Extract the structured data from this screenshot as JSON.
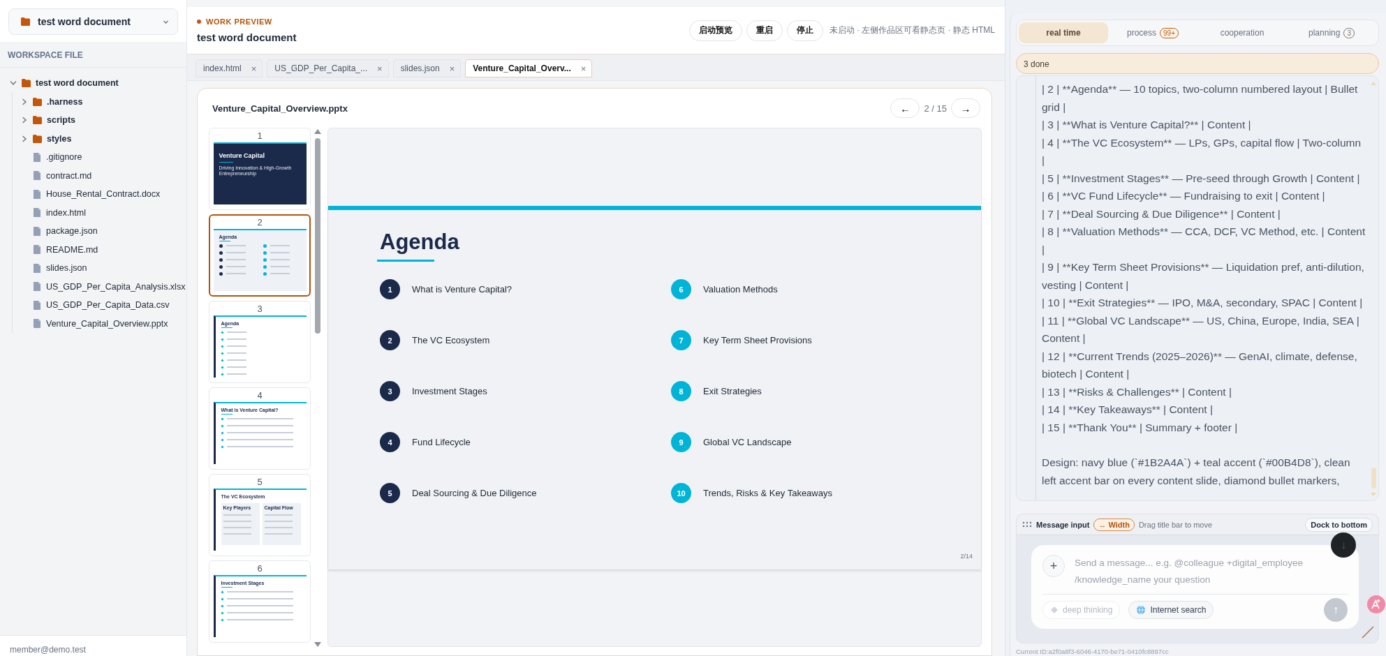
{
  "workspace_selector": {
    "label": "test word document"
  },
  "sidebar": {
    "heading": "WORKSPACE FILE",
    "user": "member@demo.test",
    "tree": [
      {
        "kind": "folder",
        "name": "test word document",
        "expanded": true,
        "children": [
          {
            "kind": "folder",
            "name": ".harness",
            "expanded": false
          },
          {
            "kind": "folder",
            "name": "scripts",
            "expanded": false
          },
          {
            "kind": "folder",
            "name": "styles",
            "expanded": false
          },
          {
            "kind": "file",
            "name": ".gitignore"
          },
          {
            "kind": "file",
            "name": "contract.md"
          },
          {
            "kind": "file",
            "name": "House_Rental_Contract.docx"
          },
          {
            "kind": "file",
            "name": "index.html"
          },
          {
            "kind": "file",
            "name": "package.json"
          },
          {
            "kind": "file",
            "name": "README.md"
          },
          {
            "kind": "file",
            "name": "slides.json"
          },
          {
            "kind": "file",
            "name": "US_GDP_Per_Capita_Analysis.xlsx"
          },
          {
            "kind": "file",
            "name": "US_GDP_Per_Capita_Data.csv"
          },
          {
            "kind": "file",
            "name": "Venture_Capital_Overview.pptx"
          }
        ]
      }
    ]
  },
  "preview": {
    "eyebrow": "WORK PREVIEW",
    "title": "test word document",
    "buttons": [
      "启动预览",
      "重启",
      "停止"
    ],
    "status": "未启动 · 左侧作品区可看静态页 · 静态 HTML",
    "tabs": [
      {
        "label": "index.html",
        "close": "×",
        "selected": false
      },
      {
        "label": "US_GDP_Per_Capita_...",
        "close": "×",
        "selected": false
      },
      {
        "label": "slides.json",
        "close": "×",
        "selected": false
      },
      {
        "label": "Venture_Capital_Overv...",
        "close": "×",
        "selected": true
      }
    ],
    "viewer": {
      "file": "Venture_Capital_Overview.pptx",
      "prev": "←",
      "page": "2 / 15",
      "next": "→",
      "thumbnails": [
        {
          "number": "1",
          "kind": "title",
          "title": "Venture Capital",
          "subtitle": "Driving Innovation & High-Growth Entrepreneurship",
          "selected": false
        },
        {
          "number": "2",
          "kind": "agenda",
          "title": "Agenda",
          "selected": true
        },
        {
          "number": "3",
          "kind": "list",
          "title": "Agenda",
          "selected": false
        },
        {
          "number": "4",
          "kind": "bullets",
          "title": "What is Venture Capital?",
          "selected": false
        },
        {
          "number": "5",
          "kind": "columns",
          "title": "The VC Ecosystem",
          "column_titles": [
            "Key Players",
            "Capital Flow"
          ],
          "selected": false
        },
        {
          "number": "6",
          "kind": "bullets",
          "title": "Investment Stages",
          "selected": false
        }
      ],
      "slide": {
        "title": "Agenda",
        "page": "2/14",
        "items": [
          {
            "number": "1",
            "label": "What is Venture Capital?",
            "color": "#1b2a4a"
          },
          {
            "number": "6",
            "label": "Valuation Methods",
            "color": "#00b4d8"
          },
          {
            "number": "2",
            "label": "The VC Ecosystem",
            "color": "#1b2a4a"
          },
          {
            "number": "7",
            "label": "Key Term Sheet Provisions",
            "color": "#00b4d8"
          },
          {
            "number": "3",
            "label": "Investment Stages",
            "color": "#1b2a4a"
          },
          {
            "number": "8",
            "label": "Exit Strategies",
            "color": "#00b4d8"
          },
          {
            "number": "4",
            "label": "Fund Lifecycle",
            "color": "#1b2a4a"
          },
          {
            "number": "9",
            "label": "Global VC Landscape",
            "color": "#00b4d8"
          },
          {
            "number": "5",
            "label": "Deal Sourcing & Due Diligence",
            "color": "#1b2a4a"
          },
          {
            "number": "10",
            "label": "Trends, Risks & Key Takeaways",
            "color": "#00b4d8"
          }
        ]
      }
    }
  },
  "assistant": {
    "tabs": [
      {
        "label": "real time",
        "selected": true
      },
      {
        "label": "process",
        "badge": {
          "text": "99+",
          "color": "#c2570c"
        },
        "selected": false
      },
      {
        "label": "cooperation",
        "selected": false
      },
      {
        "label": "planning",
        "badge": {
          "text": "3",
          "color": "#64748b"
        },
        "selected": false
      }
    ],
    "progress": "3 done",
    "messages": [
      "| 2 | **Agenda** — 10 topics, two-column numbered layout | Bullet grid |",
      "| 3 | **What is Venture Capital?** | Content |",
      "| 4 | **The VC Ecosystem** — LPs, GPs, capital flow | Two-column |",
      "| 5 | **Investment Stages** — Pre-seed through Growth | Content |",
      "| 6 | **VC Fund Lifecycle** — Fundraising to exit | Content |",
      "| 7 | **Deal Sourcing & Due Diligence** | Content |",
      "| 8 | **Valuation Methods** — CCA, DCF, VC Method, etc. | Content |",
      "| 9 | **Key Term Sheet Provisions** — Liquidation pref, anti-dilution, vesting | Content |",
      "| 10 | **Exit Strategies** — IPO, M&A, secondary, SPAC | Content |",
      "| 11 | **Global VC Landscape** — US, China, Europe, India, SEA | Content |",
      "| 12 | **Current Trends (2025–2026)** — GenAI, climate, defense, biotech | Content |",
      "| 13 | **Risks & Challenges** | Content |",
      "| 14 | **Key Takeaways** | Content |",
      "| 15 | **Thank You** | Summary + footer |",
      "Design: navy blue (`#1B2A4A`) + teal accent (`#00B4D8`), clean left accent bar on every content slide, diamond bullet markers,"
    ],
    "composer": {
      "title": "Message input",
      "width_toggle": "↔ Width",
      "hint": "Drag title bar to move",
      "dock": "Dock to bottom",
      "scroll_down": "↓",
      "attach": "+",
      "placeholder": "Send a message... e.g. @colleague +digital_employee /knowledge_name your question",
      "options": [
        {
          "label": "deep thinking",
          "on": false
        },
        {
          "label": "Internet search",
          "on": true
        }
      ],
      "send": "↑"
    },
    "session": "Current ID:a2f0a8f3-6046-4170-be71-0410fc8897cc"
  }
}
